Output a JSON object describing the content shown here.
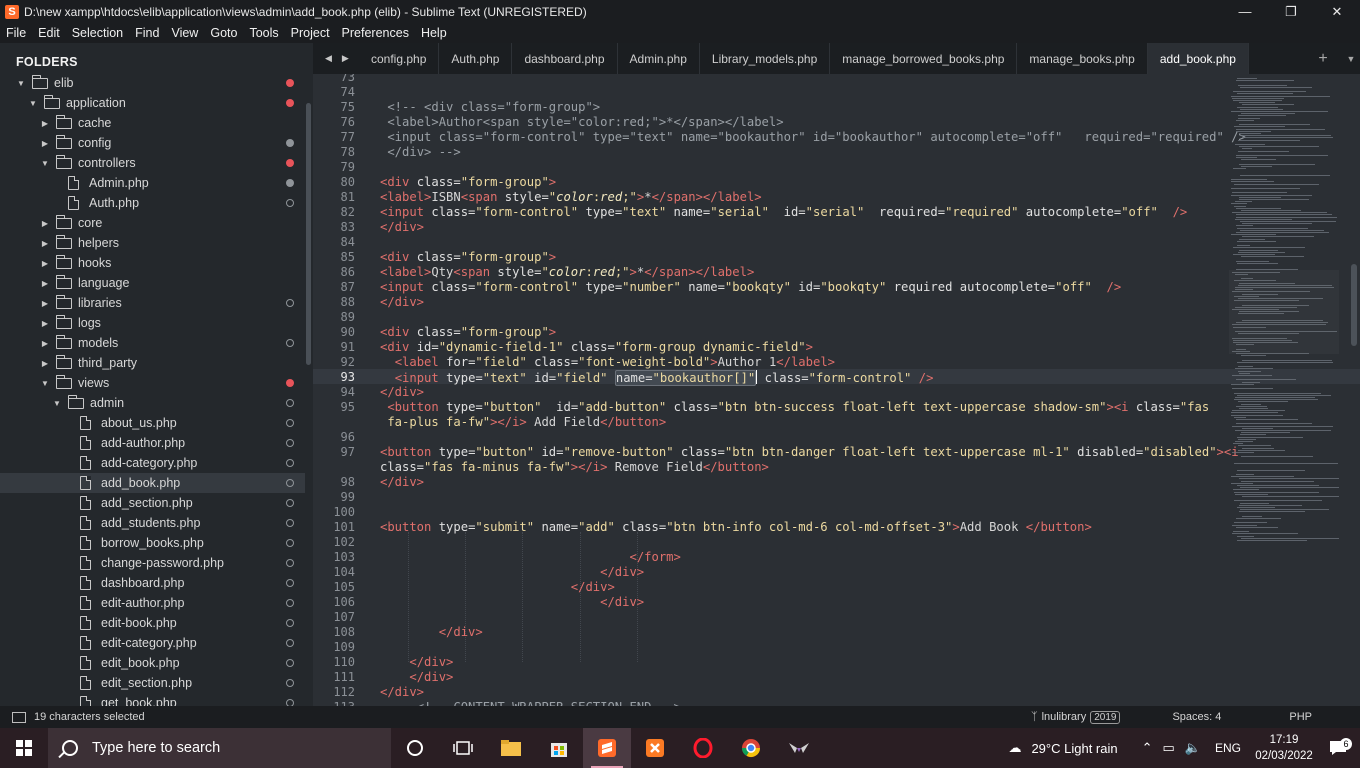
{
  "window": {
    "title": "D:\\new xampp\\htdocs\\elib\\application\\views\\admin\\add_book.php (elib) - Sublime Text (UNREGISTERED)",
    "app_icon": "S"
  },
  "menu": [
    "File",
    "Edit",
    "Selection",
    "Find",
    "View",
    "Goto",
    "Tools",
    "Project",
    "Preferences",
    "Help"
  ],
  "sidebar": {
    "heading": "FOLDERS",
    "tree": [
      {
        "label": "elib",
        "kind": "folder",
        "depth": 0,
        "open": true,
        "status": "red"
      },
      {
        "label": "application",
        "kind": "folder",
        "depth": 1,
        "open": true,
        "status": "red"
      },
      {
        "label": "cache",
        "kind": "folder",
        "depth": 2,
        "open": false,
        "status": ""
      },
      {
        "label": "config",
        "kind": "folder",
        "depth": 2,
        "open": false,
        "status": "gray"
      },
      {
        "label": "controllers",
        "kind": "folder",
        "depth": 2,
        "open": true,
        "status": "red"
      },
      {
        "label": "Admin.php",
        "kind": "file",
        "depth": 3,
        "status": "gray"
      },
      {
        "label": "Auth.php",
        "kind": "file",
        "depth": 3,
        "status": "ring"
      },
      {
        "label": "core",
        "kind": "folder",
        "depth": 2,
        "open": false,
        "status": ""
      },
      {
        "label": "helpers",
        "kind": "folder",
        "depth": 2,
        "open": false,
        "status": ""
      },
      {
        "label": "hooks",
        "kind": "folder",
        "depth": 2,
        "open": false,
        "status": ""
      },
      {
        "label": "language",
        "kind": "folder",
        "depth": 2,
        "open": false,
        "status": ""
      },
      {
        "label": "libraries",
        "kind": "folder",
        "depth": 2,
        "open": false,
        "status": "ring"
      },
      {
        "label": "logs",
        "kind": "folder",
        "depth": 2,
        "open": false,
        "status": ""
      },
      {
        "label": "models",
        "kind": "folder",
        "depth": 2,
        "open": false,
        "status": "ring"
      },
      {
        "label": "third_party",
        "kind": "folder",
        "depth": 2,
        "open": false,
        "status": ""
      },
      {
        "label": "views",
        "kind": "folder",
        "depth": 2,
        "open": true,
        "status": "red"
      },
      {
        "label": "admin",
        "kind": "folder",
        "depth": 3,
        "open": true,
        "status": "ring"
      },
      {
        "label": "about_us.php",
        "kind": "file",
        "depth": 4,
        "status": "ring"
      },
      {
        "label": "add-author.php",
        "kind": "file",
        "depth": 4,
        "status": "ring"
      },
      {
        "label": "add-category.php",
        "kind": "file",
        "depth": 4,
        "status": "ring"
      },
      {
        "label": "add_book.php",
        "kind": "file",
        "depth": 4,
        "status": "ring",
        "selected": true
      },
      {
        "label": "add_section.php",
        "kind": "file",
        "depth": 4,
        "status": "ring"
      },
      {
        "label": "add_students.php",
        "kind": "file",
        "depth": 4,
        "status": "ring"
      },
      {
        "label": "borrow_books.php",
        "kind": "file",
        "depth": 4,
        "status": "ring"
      },
      {
        "label": "change-password.php",
        "kind": "file",
        "depth": 4,
        "status": "ring"
      },
      {
        "label": "dashboard.php",
        "kind": "file",
        "depth": 4,
        "status": "ring"
      },
      {
        "label": "edit-author.php",
        "kind": "file",
        "depth": 4,
        "status": "ring"
      },
      {
        "label": "edit-book.php",
        "kind": "file",
        "depth": 4,
        "status": "ring"
      },
      {
        "label": "edit-category.php",
        "kind": "file",
        "depth": 4,
        "status": "ring"
      },
      {
        "label": "edit_book.php",
        "kind": "file",
        "depth": 4,
        "status": "ring"
      },
      {
        "label": "edit_section.php",
        "kind": "file",
        "depth": 4,
        "status": "ring"
      },
      {
        "label": "get_book.php",
        "kind": "file",
        "depth": 4,
        "status": "ring"
      }
    ]
  },
  "tabs": [
    {
      "label": "config.php",
      "active": false
    },
    {
      "label": "Auth.php",
      "active": false
    },
    {
      "label": "dashboard.php",
      "active": false
    },
    {
      "label": "Admin.php",
      "active": false
    },
    {
      "label": "Library_models.php",
      "active": false
    },
    {
      "label": "manage_borrowed_books.php",
      "active": false
    },
    {
      "label": "manage_books.php",
      "active": false
    },
    {
      "label": "add_book.php",
      "active": true
    }
  ],
  "editor": {
    "current_line": "93",
    "lines": [
      {
        "n": "73",
        "html": ""
      },
      {
        "n": "74",
        "html": ""
      },
      {
        "n": "75",
        "html": " <span class=\"c\">&lt;!-- &lt;div class=\"form-group\"&gt;</span>"
      },
      {
        "n": "76",
        "html": " <span class=\"c\">&lt;label&gt;Author&lt;span style=\"color:red;\"&gt;*&lt;/span&gt;&lt;/label&gt;</span>"
      },
      {
        "n": "77",
        "html": " <span class=\"c\">&lt;input class=\"form-control\" type=\"text\" name=\"bookauthor\" id=\"bookauthor\" autocomplete=\"off\"   required=\"required\" /&gt;</span>"
      },
      {
        "n": "78",
        "html": " <span class=\"c\">&lt;/div&gt; --&gt;</span>"
      },
      {
        "n": "79",
        "html": ""
      },
      {
        "n": "80",
        "html": "<span class=\"t\">&lt;div</span> <span class=\"a\">class=</span><span class=\"s\">\"form-group\"</span><span class=\"t\">&gt;</span>"
      },
      {
        "n": "81",
        "html": "<span class=\"t\">&lt;label&gt;</span>ISBN<span class=\"t\">&lt;span</span> <span class=\"a\">style=</span><span class=\"s\">\"</span><span class=\"it\">color</span><span class=\"s\">:</span><span class=\"it\">red</span><span class=\"s\">;\"</span><span class=\"t\">&gt;</span>*<span class=\"t\">&lt;/span&gt;&lt;/label&gt;</span>"
      },
      {
        "n": "82",
        "html": "<span class=\"t\">&lt;input</span> <span class=\"a\">class=</span><span class=\"s\">\"form-control\"</span> <span class=\"a\">type=</span><span class=\"s\">\"text\"</span> <span class=\"a\">name=</span><span class=\"s\">\"serial\"</span>  <span class=\"a\">id=</span><span class=\"s\">\"serial\"</span>  <span class=\"a\">required=</span><span class=\"s\">\"required\"</span> <span class=\"a\">autocomplete=</span><span class=\"s\">\"off\"</span>  <span class=\"t\">/&gt;</span>"
      },
      {
        "n": "83",
        "html": "<span class=\"t\">&lt;/div&gt;</span>"
      },
      {
        "n": "84",
        "html": ""
      },
      {
        "n": "85",
        "html": "<span class=\"t\">&lt;div</span> <span class=\"a\">class=</span><span class=\"s\">\"form-group\"</span><span class=\"t\">&gt;</span>"
      },
      {
        "n": "86",
        "html": "<span class=\"t\">&lt;label&gt;</span>Qty<span class=\"t\">&lt;span</span> <span class=\"a\">style=</span><span class=\"s\">\"</span><span class=\"it\">color</span><span class=\"s\">:</span><span class=\"it\">red</span><span class=\"s\">;\"</span><span class=\"t\">&gt;</span>*<span class=\"t\">&lt;/span&gt;&lt;/label&gt;</span>"
      },
      {
        "n": "87",
        "html": "<span class=\"t\">&lt;input</span> <span class=\"a\">class=</span><span class=\"s\">\"form-control\"</span> <span class=\"a\">type=</span><span class=\"s\">\"number\"</span> <span class=\"a\">name=</span><span class=\"s\">\"bookqty\"</span> <span class=\"a\">id=</span><span class=\"s\">\"bookqty\"</span> <span class=\"a\">required autocomplete=</span><span class=\"s\">\"off\"</span>  <span class=\"t\">/&gt;</span>"
      },
      {
        "n": "88",
        "html": "<span class=\"t\">&lt;/div&gt;</span>"
      },
      {
        "n": "89",
        "html": ""
      },
      {
        "n": "90",
        "html": "<span class=\"t\">&lt;div</span> <span class=\"a\">class=</span><span class=\"s\">\"form-group\"</span><span class=\"t\">&gt;</span>"
      },
      {
        "n": "91",
        "html": "<span class=\"t\">&lt;div</span> <span class=\"a\">id=</span><span class=\"s\">\"dynamic-field-1\"</span> <span class=\"a\">class=</span><span class=\"s\">\"form-group dynamic-field\"</span><span class=\"t\">&gt;</span>"
      },
      {
        "n": "92",
        "html": "  <span class=\"t\">&lt;label</span> <span class=\"a\">for=</span><span class=\"s\">\"field\"</span> <span class=\"a\">class=</span><span class=\"s\">\"font-weight-bold\"</span><span class=\"t\">&gt;</span>Author 1<span class=\"t\">&lt;/label&gt;</span>"
      },
      {
        "n": "93",
        "html": "  <span class=\"t\">&lt;input</span> <span class=\"a\">type=</span><span class=\"s\">\"text\"</span> <span class=\"a\">id=</span><span class=\"s\">\"field\"</span> <span class=\"hl\"><span class=\"a\">name=</span><span class=\"s\">\"bookauthor[]\"</span></span><span class=\"caret\"></span> <span class=\"a\">class=</span><span class=\"s\">\"form-control\"</span> <span class=\"t\">/&gt;</span>"
      },
      {
        "n": "94",
        "html": "<span class=\"t\">&lt;/div&gt;</span>"
      },
      {
        "n": "95",
        "html": " <span class=\"t\">&lt;button</span> <span class=\"a\">type=</span><span class=\"s\">\"button\"</span>  <span class=\"a\">id=</span><span class=\"s\">\"add-button\"</span> <span class=\"a\">class=</span><span class=\"s\">\"btn btn-success float-left text-uppercase shadow-sm\"</span><span class=\"t\">&gt;&lt;i</span> <span class=\"a\">class=</span><span class=\"s\">\"fas</span>"
      },
      {
        "n": "",
        "html": " <span class=\"s\">fa-plus fa-fw\"</span><span class=\"t\">&gt;&lt;/i&gt;</span> Add Field<span class=\"t\">&lt;/button&gt;</span>"
      },
      {
        "n": "96",
        "html": ""
      },
      {
        "n": "97",
        "html": "<span class=\"t\">&lt;button</span> <span class=\"a\">type=</span><span class=\"s\">\"button\"</span> <span class=\"a\">id=</span><span class=\"s\">\"remove-button\"</span> <span class=\"a\">class=</span><span class=\"s\">\"btn btn-danger float-left text-uppercase ml-1\"</span> <span class=\"a\">disabled=</span><span class=\"s\">\"disabled\"</span><span class=\"t\">&gt;&lt;i</span>"
      },
      {
        "n": "",
        "html": "<span class=\"a\">class=</span><span class=\"s\">\"fas fa-minus fa-fw\"</span><span class=\"t\">&gt;&lt;/i&gt;</span> Remove Field<span class=\"t\">&lt;/button&gt;</span>"
      },
      {
        "n": "98",
        "html": "<span class=\"t\">&lt;/div&gt;</span>"
      },
      {
        "n": "99",
        "html": ""
      },
      {
        "n": "100",
        "html": ""
      },
      {
        "n": "101",
        "html": "<span class=\"t\">&lt;button</span> <span class=\"a\">type=</span><span class=\"s\">\"submit\"</span> <span class=\"a\">name=</span><span class=\"s\">\"add\"</span> <span class=\"a\">class=</span><span class=\"s\">\"btn btn-info col-md-6 col-md-offset-3\"</span><span class=\"t\">&gt;</span>Add Book <span class=\"t\">&lt;/button&gt;</span>"
      },
      {
        "n": "102",
        "html": ""
      },
      {
        "n": "103",
        "html": "                                  <span class=\"t\">&lt;/form&gt;</span>"
      },
      {
        "n": "104",
        "html": "                              <span class=\"t\">&lt;/div&gt;</span>"
      },
      {
        "n": "105",
        "html": "                          <span class=\"t\">&lt;/div&gt;</span>"
      },
      {
        "n": "106",
        "html": "                              <span class=\"t\">&lt;/div&gt;</span>"
      },
      {
        "n": "107",
        "html": ""
      },
      {
        "n": "108",
        "html": "        <span class=\"t\">&lt;/div&gt;</span>"
      },
      {
        "n": "109",
        "html": ""
      },
      {
        "n": "110",
        "html": "    <span class=\"t\">&lt;/div&gt;</span>"
      },
      {
        "n": "111",
        "html": "    <span class=\"t\">&lt;/div&gt;</span>"
      },
      {
        "n": "112",
        "html": "<span class=\"t\">&lt;/div&gt;</span>"
      },
      {
        "n": "113",
        "html": "     <span class=\"c\">&lt;!-- CONTENT-WRAPPER SECTION END --&gt;</span>"
      }
    ]
  },
  "status": {
    "selection": "19 characters selected",
    "branch": "lnulibrary",
    "branch_badge": "2019",
    "spaces": "Spaces: 4",
    "syntax": "PHP"
  },
  "taskbar": {
    "search_placeholder": "Type here to search",
    "weather": "29°C  Light rain",
    "lang": "ENG",
    "time": "17:19",
    "date": "02/03/2022",
    "notifications": "6"
  }
}
